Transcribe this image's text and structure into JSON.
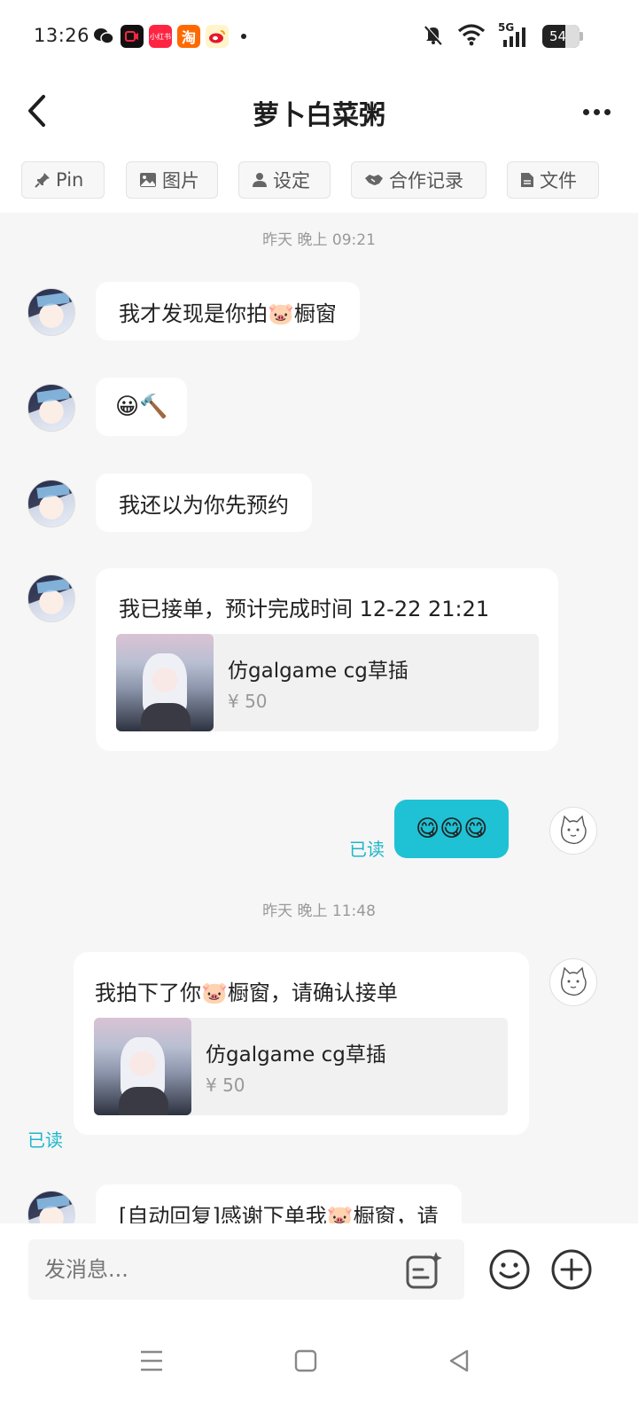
{
  "status_bar": {
    "time": "13:26",
    "battery": "54",
    "network": "5G",
    "app_icons": [
      {
        "name": "wechat-icon",
        "label": "",
        "color": "#1a1a1a"
      },
      {
        "name": "recorder-icon",
        "label": "",
        "color": "#111111"
      },
      {
        "name": "xiaohongshu-icon",
        "label": "小红书",
        "color": "#ff2442"
      },
      {
        "name": "taobao-icon",
        "label": "淘",
        "color": "#ff6a00"
      },
      {
        "name": "weibo-icon",
        "label": "",
        "color": "#f5b800"
      }
    ]
  },
  "header": {
    "title": "萝卜白菜粥"
  },
  "tabs": [
    {
      "label": "Pin",
      "icon": "pin-icon"
    },
    {
      "label": "图片",
      "icon": "image-icon"
    },
    {
      "label": "设定",
      "icon": "person-icon"
    },
    {
      "label": "合作记录",
      "icon": "handshake-icon"
    },
    {
      "label": "文件",
      "icon": "file-icon"
    }
  ],
  "messages": {
    "ts1": "昨天 晚上 09:21",
    "m1": "我才发现是你拍🐷橱窗",
    "m2": "😀🔨",
    "m3": "我还以为你先预约",
    "m4_text": "我已接单，预计完成时间 12-22 21:21",
    "m4_product_title": "仿galgame cg草插",
    "m4_product_price": "¥ 50",
    "m5": "😋😋😋",
    "m5_read": "已读",
    "ts2": "昨天 晚上 11:48",
    "m6_text": "我拍下了你🐷橱窗，请确认接单",
    "m6_product_title": "仿galgame cg草插",
    "m6_product_price": "¥ 50",
    "m6_read": "已读",
    "m7": "[自动回复]感谢下单我🐷橱窗，请"
  },
  "input_bar": {
    "placeholder": "发消息..."
  },
  "colors": {
    "accent": "#1fc1d4",
    "read": "#1fb5c9",
    "background": "#f6f6f6"
  }
}
